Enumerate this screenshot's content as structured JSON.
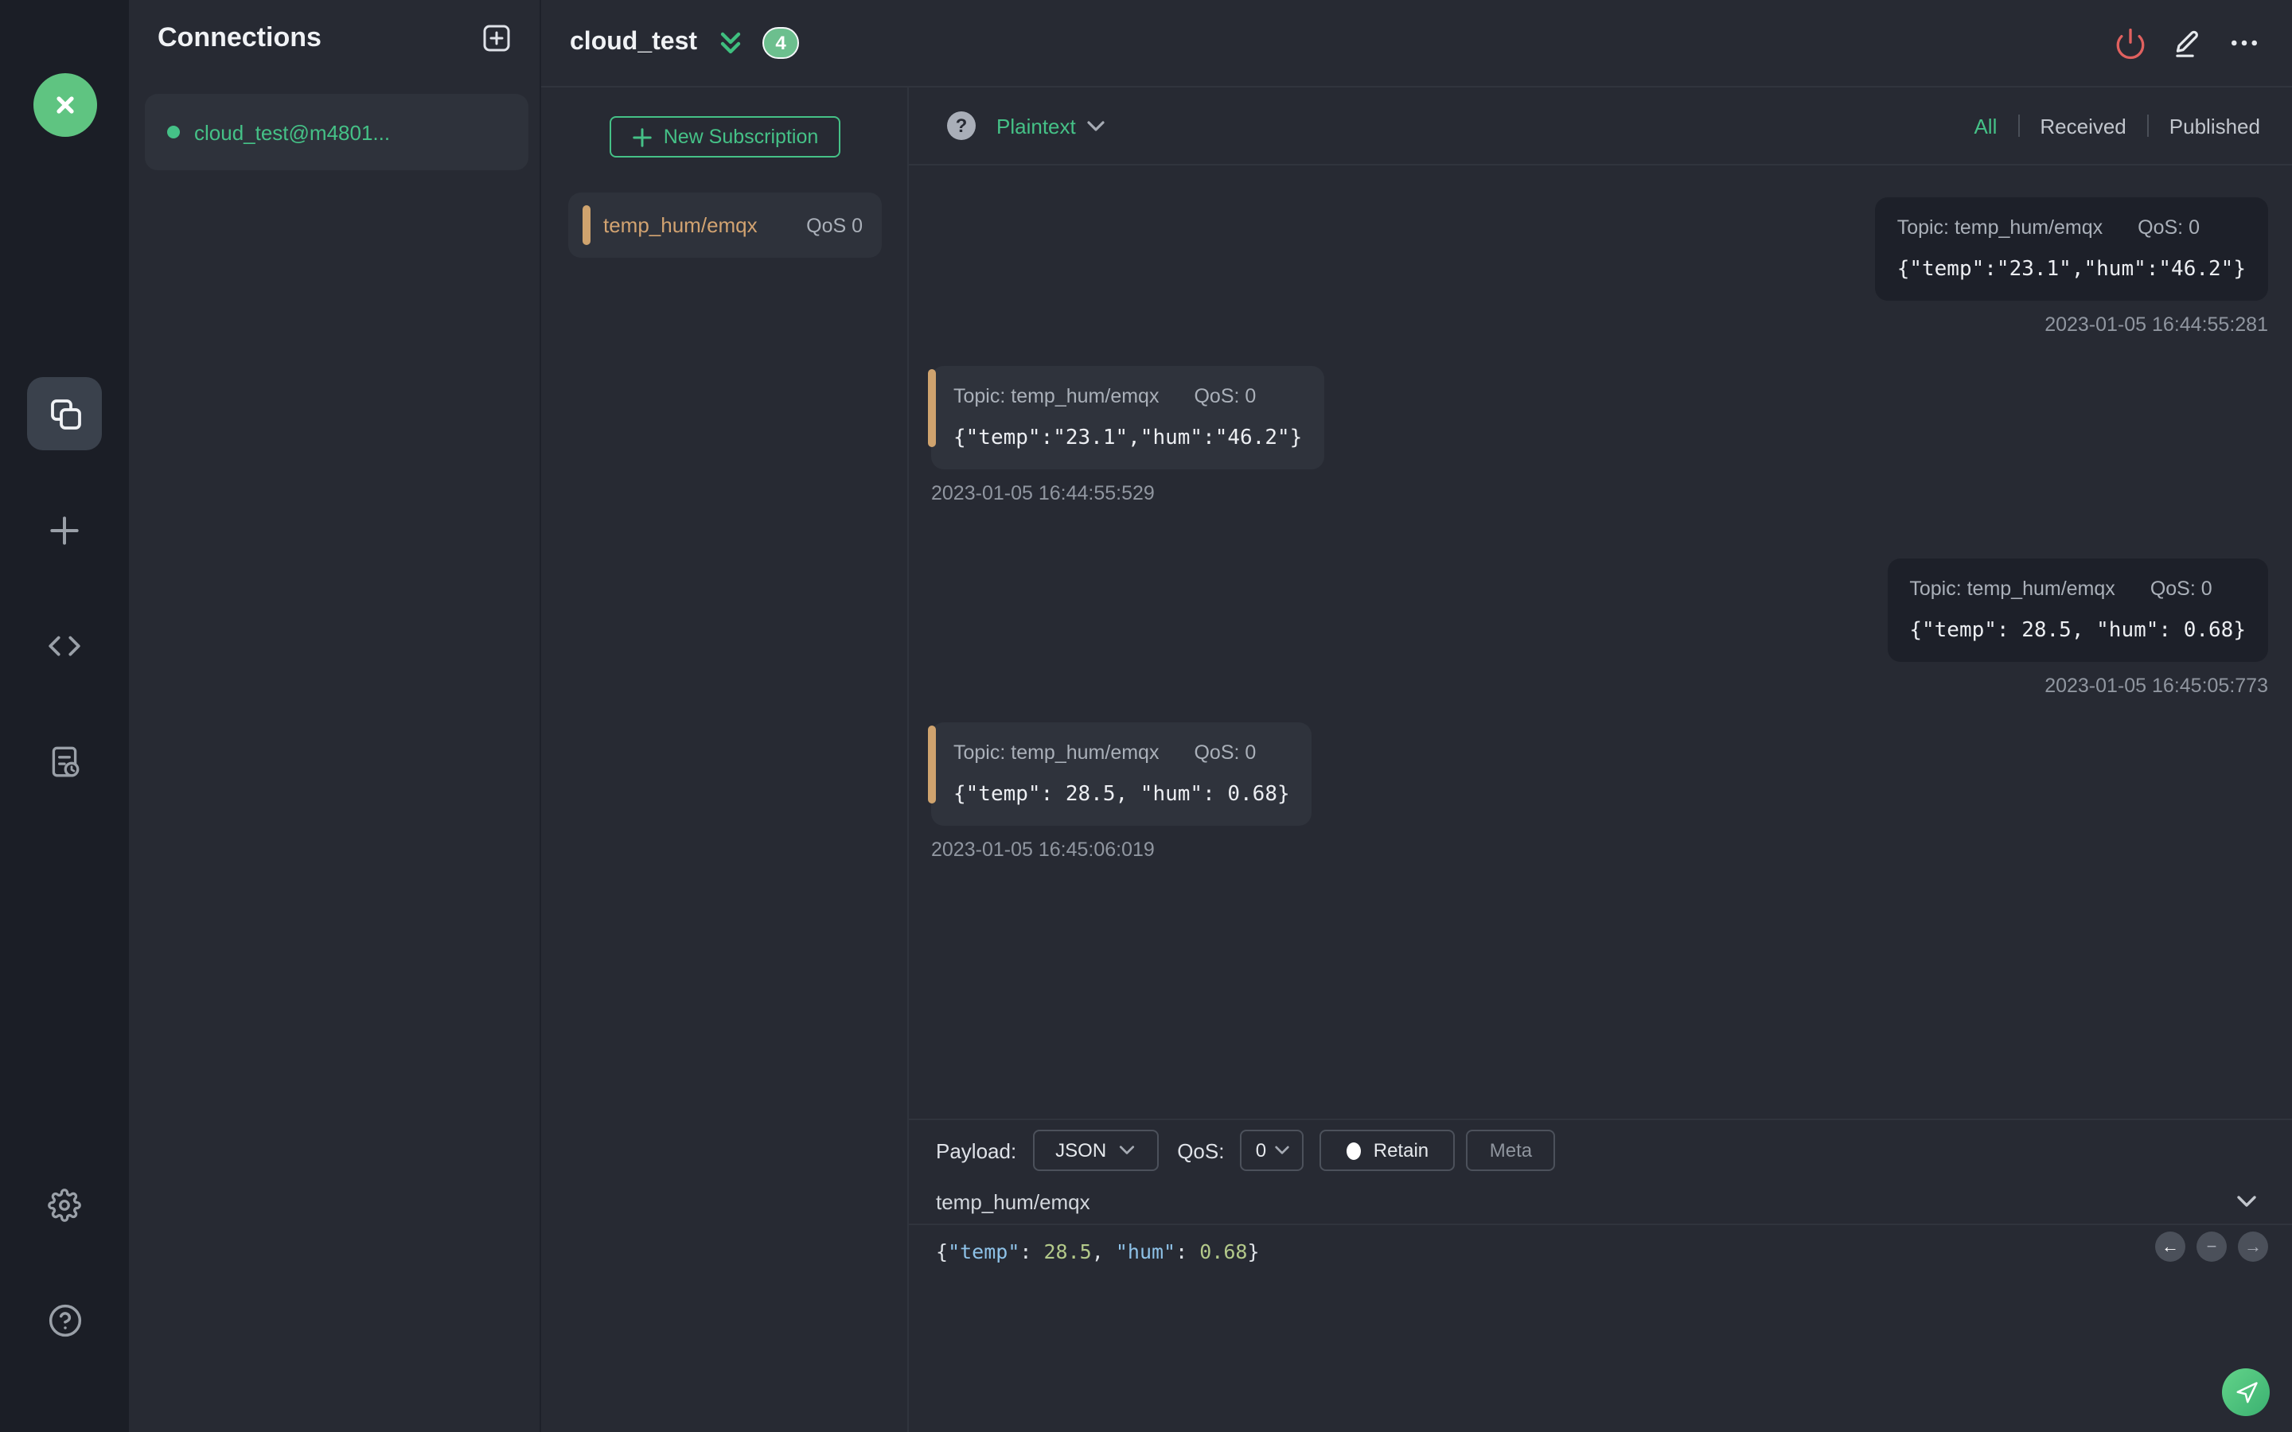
{
  "sidebar": {
    "icons": [
      "connections-icon",
      "plus-icon",
      "code-icon",
      "log-icon",
      "gear-icon",
      "help-icon"
    ]
  },
  "connections": {
    "title": "Connections",
    "items": [
      {
        "label": "cloud_test@m4801...",
        "active": true
      }
    ]
  },
  "header": {
    "title": "cloud_test",
    "unread_badge": "4"
  },
  "subscriptions": {
    "new_label": "New Subscription",
    "items": [
      {
        "topic": "temp_hum/emqx",
        "qos": "QoS 0"
      }
    ]
  },
  "messages": {
    "format": "Plaintext",
    "help_icon": "?",
    "filters": {
      "all": "All",
      "received": "Received",
      "published": "Published"
    },
    "active_filter": "All",
    "items": [
      {
        "direction": "published",
        "topic": "Topic: temp_hum/emqx",
        "qos": "QoS: 0",
        "payload": "{\"temp\":\"23.1\",\"hum\":\"46.2\"}",
        "time": "2023-01-05 16:44:55:281"
      },
      {
        "direction": "received",
        "topic": "Topic: temp_hum/emqx",
        "qos": "QoS: 0",
        "payload": "{\"temp\":\"23.1\",\"hum\":\"46.2\"}",
        "time": "2023-01-05 16:44:55:529"
      },
      {
        "direction": "published",
        "topic": "Topic: temp_hum/emqx",
        "qos": "QoS: 0",
        "payload": "{\"temp\": 28.5, \"hum\": 0.68}",
        "time": "2023-01-05 16:45:05:773"
      },
      {
        "direction": "received",
        "topic": "Topic: temp_hum/emqx",
        "qos": "QoS: 0",
        "payload": "{\"temp\": 28.5, \"hum\": 0.68}",
        "time": "2023-01-05 16:45:06:019"
      }
    ]
  },
  "publish": {
    "payload_label": "Payload:",
    "payload_type": "JSON",
    "qos_label": "QoS:",
    "qos_value": "0",
    "retain_label": "Retain",
    "meta_label": "Meta",
    "topic_value": "temp_hum/emqx",
    "editor": {
      "open_brace": "{",
      "key1": "\"temp\"",
      "colon1": ": ",
      "num1": "28.5",
      "comma": ", ",
      "key2": "\"hum\"",
      "colon2": ": ",
      "num2": "0.68",
      "close_brace": "}"
    },
    "pager": {
      "prev": "←",
      "collapse": "−",
      "next": "→"
    }
  },
  "colors": {
    "accent_green": "#45c187",
    "topic_orange": "#d2a371",
    "power_red": "#e0615f",
    "syntax_key_blue": "#8ec2e8",
    "syntax_number_green": "#b3c98a"
  }
}
